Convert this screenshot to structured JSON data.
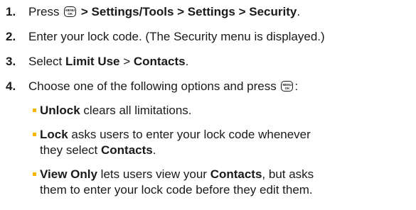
{
  "accent_color": "#f7b500",
  "menu_key": {
    "line1": "MENU",
    "line2": "OK"
  },
  "steps": [
    {
      "num": "1.",
      "pre": "Press ",
      "bold": " > Settings/Tools > Settings > Security",
      "post": "."
    },
    {
      "num": "2.",
      "text": "Enter your lock code. (The Security menu is displayed.)"
    },
    {
      "num": "3.",
      "pre": "Select ",
      "bold1": "Limit Use",
      "sep": " > ",
      "bold2": "Contacts",
      "post": "."
    },
    {
      "num": "4.",
      "pre": "Choose one of the following options and press ",
      "post": ":"
    }
  ],
  "options": [
    {
      "bold": "Unlock",
      "text": " clears all limitations."
    },
    {
      "bold": "Lock",
      "line1": " asks users to enter your lock code whenever",
      "line2_pre": "they select ",
      "line2_bold": "Contacts",
      "line2_post": "."
    },
    {
      "bold": "View Only",
      "line1_mid": " lets users view your ",
      "line1_bold": "Contacts",
      "line1_post": ", but asks",
      "line2": "them to enter your lock code before they edit them."
    }
  ]
}
